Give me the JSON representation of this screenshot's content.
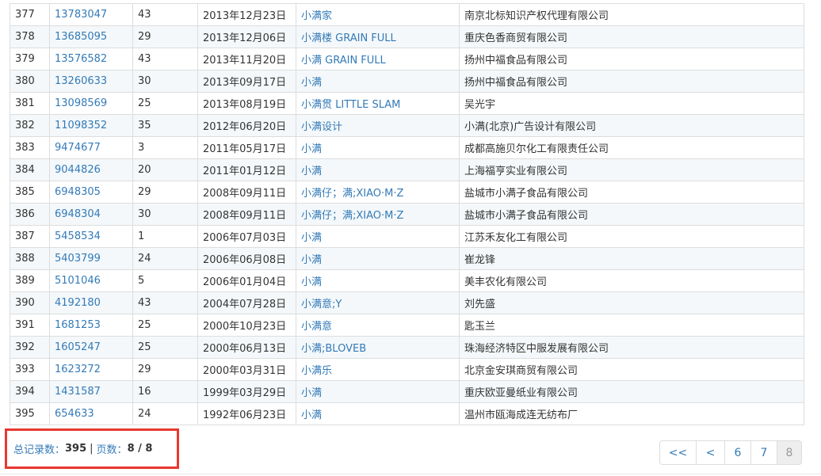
{
  "rows": [
    {
      "no": "377",
      "reg": "13783047",
      "cls": "43",
      "date": "2013年12月23日",
      "name": "小满家",
      "owner": "南京北标知识产权代理有限公司"
    },
    {
      "no": "378",
      "reg": "13685095",
      "cls": "29",
      "date": "2013年12月06日",
      "name": "小满楼 GRAIN FULL",
      "owner": "重庆色香商贸有限公司"
    },
    {
      "no": "379",
      "reg": "13576582",
      "cls": "43",
      "date": "2013年11月20日",
      "name": "小满 GRAIN FULL",
      "owner": "扬州中福食品有限公司"
    },
    {
      "no": "380",
      "reg": "13260633",
      "cls": "30",
      "date": "2013年09月17日",
      "name": "小满",
      "owner": "扬州中福食品有限公司"
    },
    {
      "no": "381",
      "reg": "13098569",
      "cls": "25",
      "date": "2013年08月19日",
      "name": "小满贯 LITTLE SLAM",
      "owner": "吴光宇"
    },
    {
      "no": "382",
      "reg": "11098352",
      "cls": "35",
      "date": "2012年06月20日",
      "name": "小满设计",
      "owner": "小满(北京)广告设计有限公司"
    },
    {
      "no": "383",
      "reg": "9474677",
      "cls": "3",
      "date": "2011年05月17日",
      "name": "小满",
      "owner": "成都高施贝尔化工有限责任公司"
    },
    {
      "no": "384",
      "reg": "9044826",
      "cls": "20",
      "date": "2011年01月12日",
      "name": "小满",
      "owner": "上海福亨实业有限公司"
    },
    {
      "no": "385",
      "reg": "6948305",
      "cls": "29",
      "date": "2008年09月11日",
      "name": "小满仔；满;XIAO·M·Z",
      "owner": "盐城市小满子食品有限公司"
    },
    {
      "no": "386",
      "reg": "6948304",
      "cls": "30",
      "date": "2008年09月11日",
      "name": "小满仔；满;XIAO·M·Z",
      "owner": "盐城市小满子食品有限公司"
    },
    {
      "no": "387",
      "reg": "5458534",
      "cls": "1",
      "date": "2006年07月03日",
      "name": "小满",
      "owner": "江苏禾友化工有限公司"
    },
    {
      "no": "388",
      "reg": "5403799",
      "cls": "24",
      "date": "2006年06月08日",
      "name": "小满",
      "owner": "崔龙锋"
    },
    {
      "no": "389",
      "reg": "5101046",
      "cls": "5",
      "date": "2006年01月04日",
      "name": "小满",
      "owner": "美丰农化有限公司"
    },
    {
      "no": "390",
      "reg": "4192180",
      "cls": "43",
      "date": "2004年07月28日",
      "name": "小满意;Y",
      "owner": "刘先盛"
    },
    {
      "no": "391",
      "reg": "1681253",
      "cls": "25",
      "date": "2000年10月23日",
      "name": "小满意",
      "owner": "匙玉兰"
    },
    {
      "no": "392",
      "reg": "1605247",
      "cls": "25",
      "date": "2000年06月13日",
      "name": "小满;BLOVEB",
      "owner": "珠海经济特区中服发展有限公司"
    },
    {
      "no": "393",
      "reg": "1623272",
      "cls": "29",
      "date": "2000年03月31日",
      "name": "小满乐",
      "owner": "北京金安琪商贸有限公司"
    },
    {
      "no": "394",
      "reg": "1431587",
      "cls": "16",
      "date": "1999年03月29日",
      "name": "小满",
      "owner": "重庆欧亚曼纸业有限公司"
    },
    {
      "no": "395",
      "reg": "654633",
      "cls": "24",
      "date": "1992年06月23日",
      "name": "小满",
      "owner": "温州市瓯海成连无纺布厂"
    }
  ],
  "summary": {
    "total_label": "总记录数：",
    "total_value": "395",
    "separator": "|",
    "pages_label": "页数：",
    "pages_value": "8 / 8"
  },
  "pagination": {
    "first": "<<",
    "prev": "<",
    "pages": [
      "6",
      "7",
      "8"
    ],
    "active_page": "8"
  },
  "colors": {
    "link": "#337ab7",
    "highlight_box": "#e8382f",
    "row_stripe": "#f4f8fa"
  }
}
